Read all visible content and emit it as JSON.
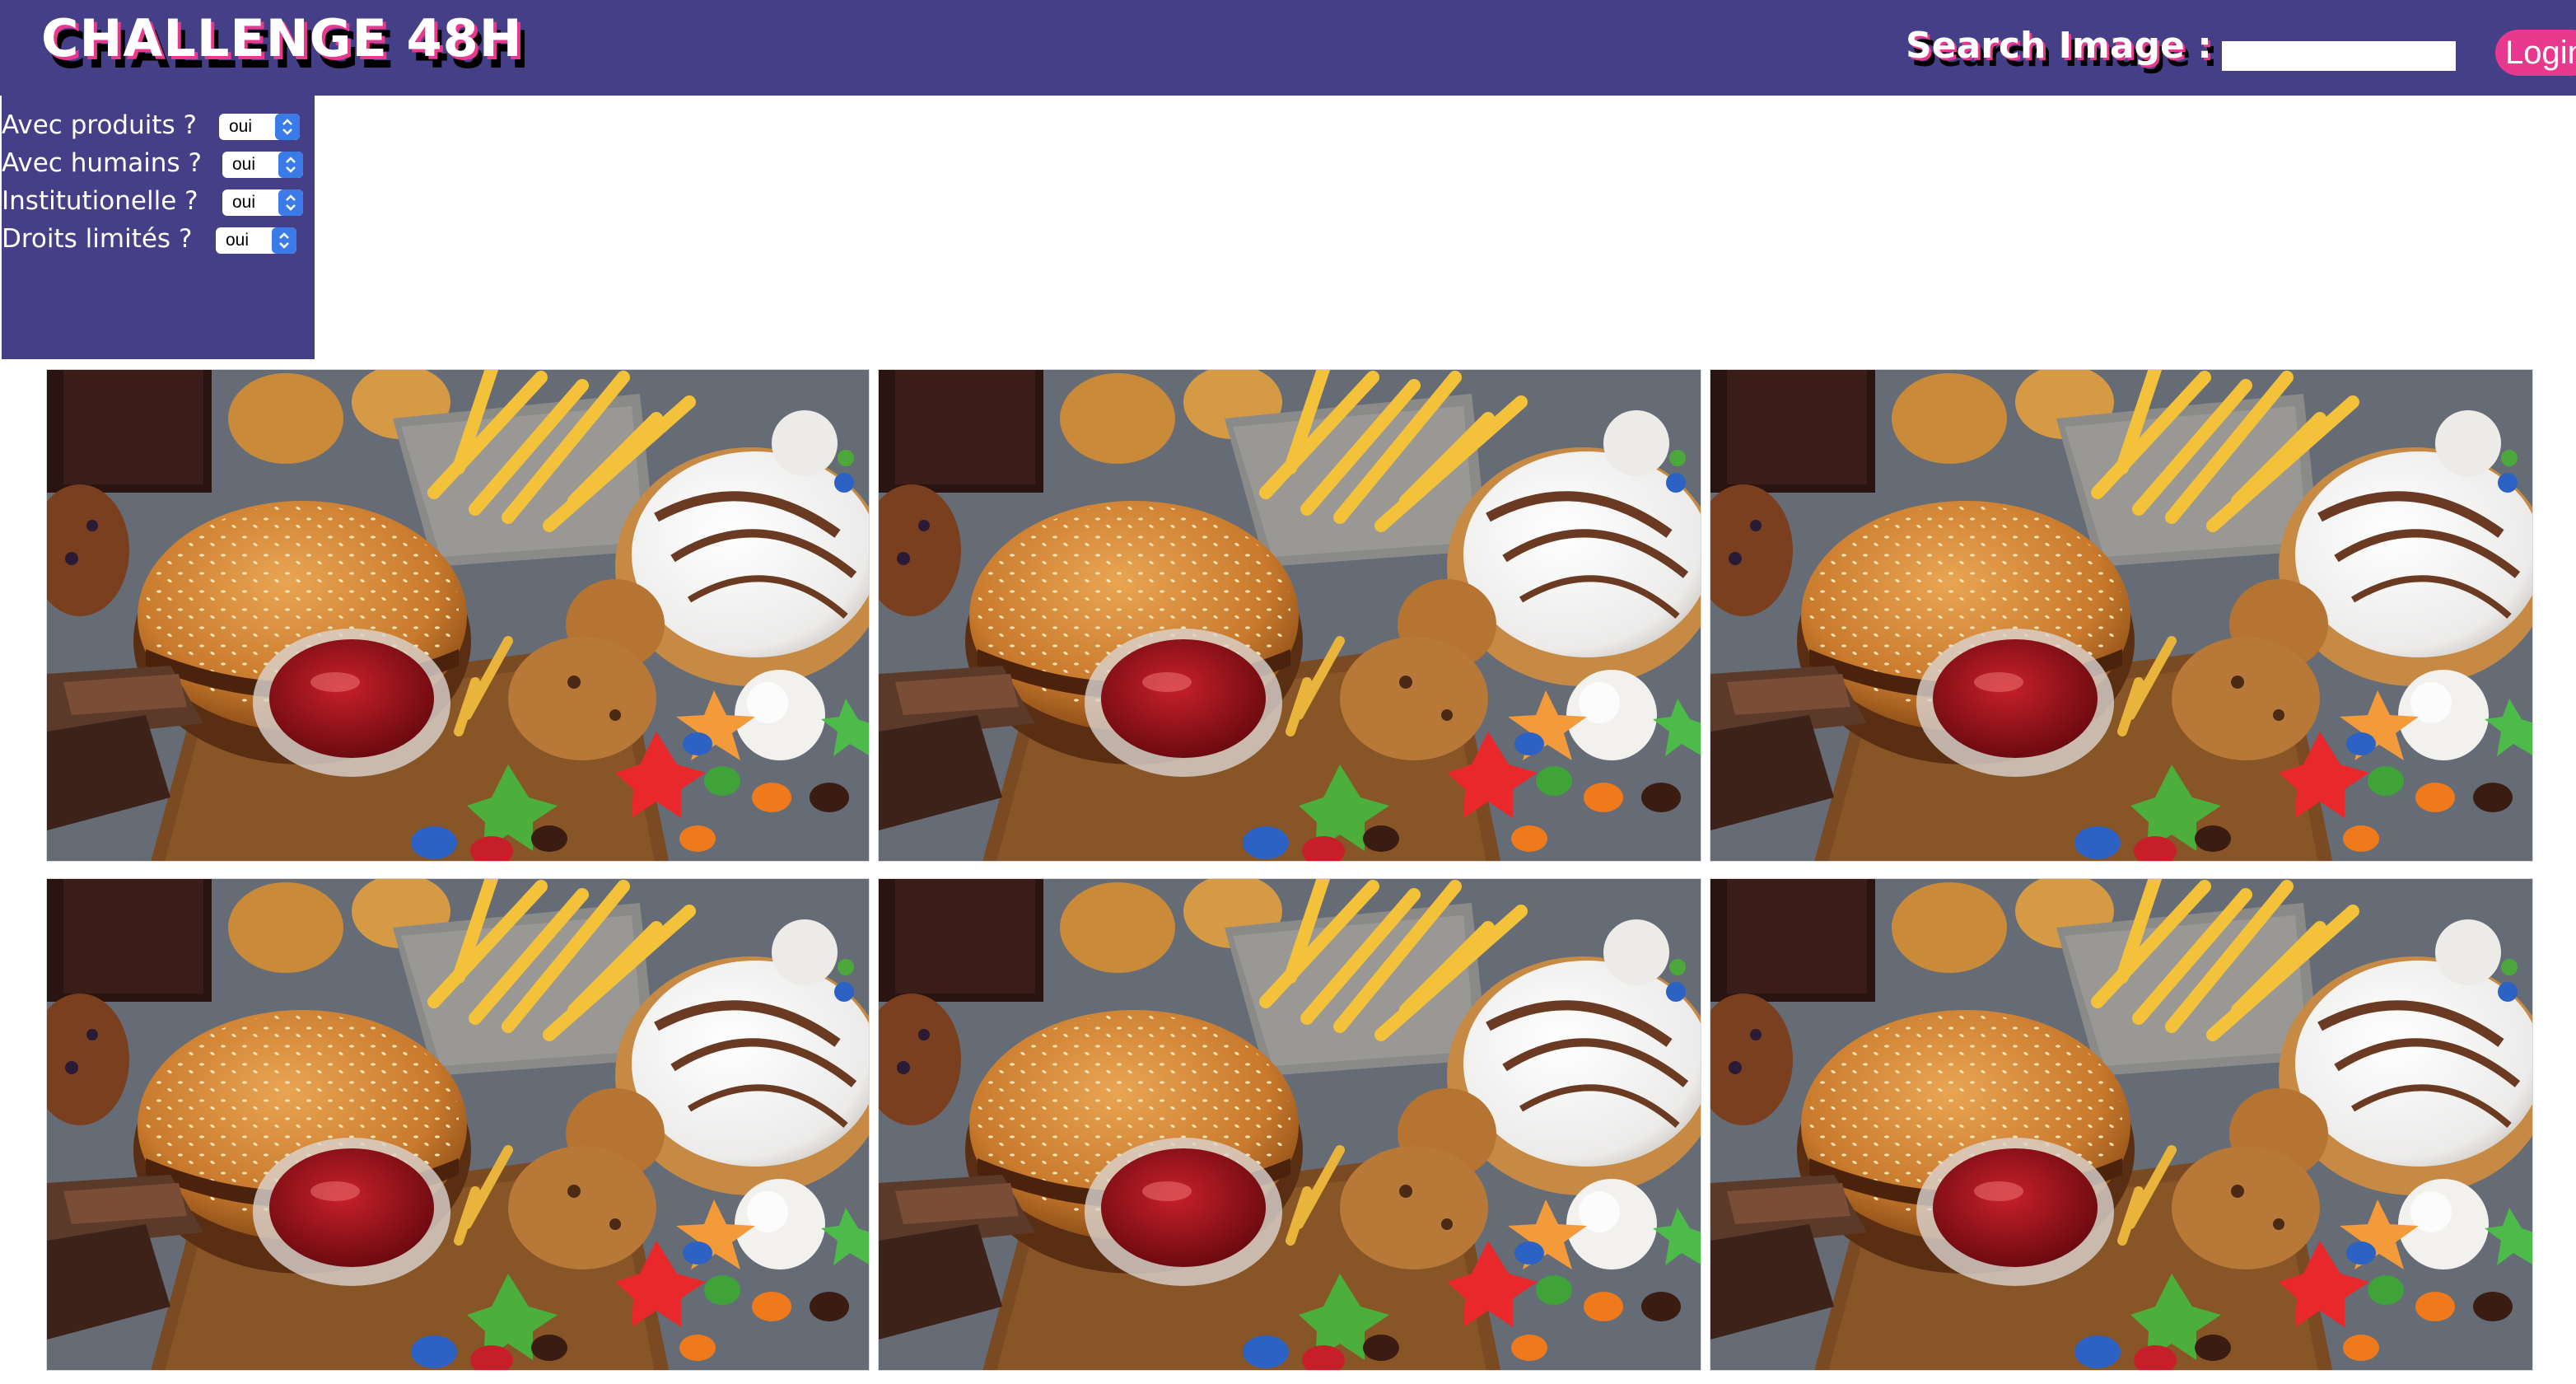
{
  "header": {
    "title": "CHALLENGE 48H",
    "search_label": "Search Image :",
    "search_value": "",
    "search_placeholder": "",
    "login_label": "Login"
  },
  "filters": [
    {
      "label": "Avec produits ?",
      "value": "oui"
    },
    {
      "label": "Avec humains ?",
      "value": "oui"
    },
    {
      "label": "Institutionelle ?",
      "value": "oui"
    },
    {
      "label": "Droits limités ?",
      "value": "oui"
    }
  ],
  "gallery": {
    "columns": 3,
    "rows": 2,
    "images": [
      {
        "subject": "fast-food-image"
      },
      {
        "subject": "fast-food-image"
      },
      {
        "subject": "fast-food-image"
      },
      {
        "subject": "fast-food-image"
      },
      {
        "subject": "fast-food-image"
      },
      {
        "subject": "fast-food-image"
      }
    ]
  },
  "colors": {
    "header_bg": "#443f86",
    "accent_pink": "#e8398e",
    "select_arrow": "#3b7be8"
  }
}
